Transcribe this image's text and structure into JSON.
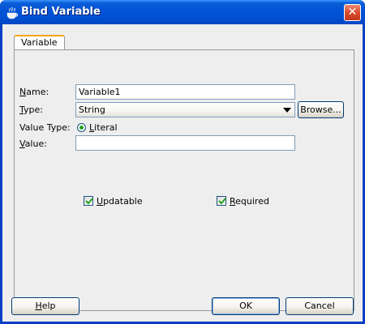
{
  "window": {
    "title": "Bind Variable",
    "close_glyph": "✕"
  },
  "tabs": [
    {
      "label": "Variable",
      "active": true
    }
  ],
  "form": {
    "name_label_key": "N",
    "name_label_rest": "ame:",
    "name_value": "Variable1",
    "type_label_key": "T",
    "type_label_rest": "ype:",
    "type_value": "String",
    "browse_label": "Browse...",
    "value_type_label": "Value Type:",
    "literal_key": "L",
    "literal_rest": "iteral",
    "literal_selected": true,
    "value_label_key": "V",
    "value_label_rest": "alue:",
    "value_value": ""
  },
  "options": {
    "updatable_key": "U",
    "updatable_rest": "pdatable",
    "updatable_checked": true,
    "required_key": "R",
    "required_rest": "equired",
    "required_checked": true
  },
  "footer": {
    "help_key": "H",
    "help_rest": "elp",
    "ok_label": "OK",
    "cancel_label": "Cancel"
  },
  "colors": {
    "titlebar": "#0453d6",
    "tab_accent": "#f4a300",
    "radio_dot": "#21a121",
    "client_bg": "#eeeeee"
  },
  "icons": {
    "title": "coffee-cup-icon",
    "close": "close-icon",
    "dropdown": "chevron-down-icon",
    "check": "checkmark-icon"
  }
}
